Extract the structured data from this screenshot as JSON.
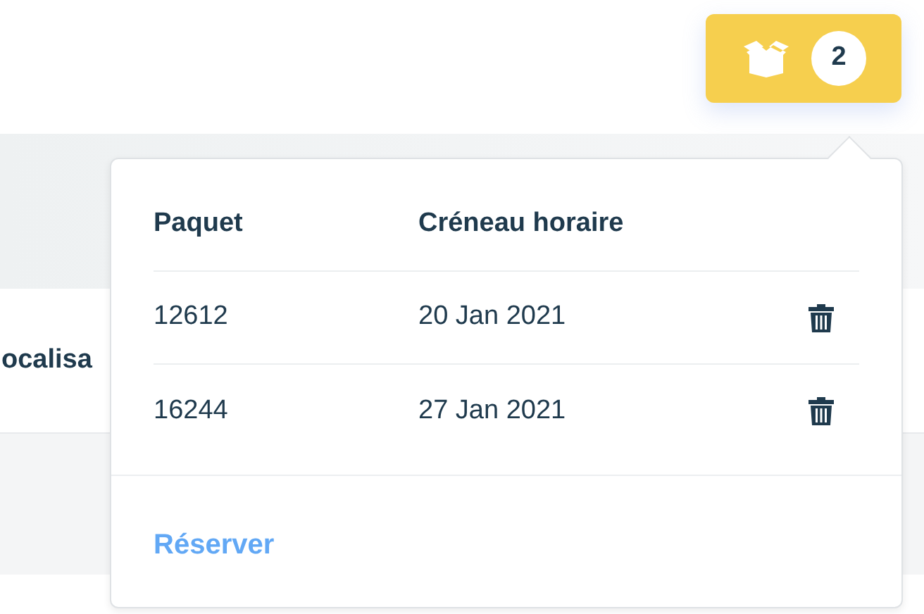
{
  "cart_button": {
    "count": "2"
  },
  "background": {
    "row_label": "ocalisa"
  },
  "popover": {
    "columns": [
      "Paquet",
      "Créneau horaire"
    ],
    "rows": [
      {
        "package": "12612",
        "slot": "20 Jan 2021"
      },
      {
        "package": "16244",
        "slot": "27 Jan 2021"
      }
    ],
    "action": "Réserver"
  }
}
